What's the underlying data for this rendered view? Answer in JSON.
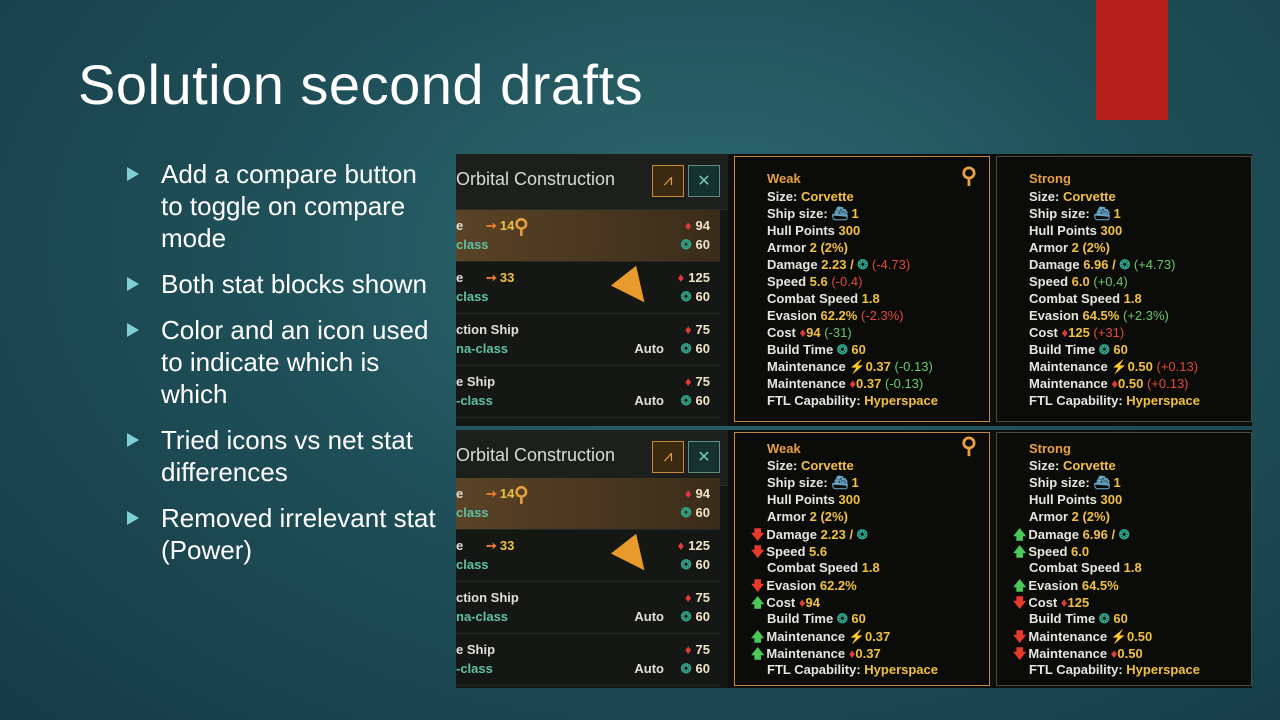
{
  "slide": {
    "title": "Solution second drafts",
    "bullets": [
      "Add a compare button to toggle on compare mode",
      "Both stat blocks shown",
      "Color and an icon used to indicate which is which",
      "Tried icons vs net stat differences",
      "Removed irrelevant stat (Power)"
    ]
  },
  "list": {
    "title": "Orbital Construction",
    "rows": [
      {
        "name1": "e",
        "num": "14",
        "name2": "class",
        "gem": "94",
        "energy": "60",
        "auto": ""
      },
      {
        "name1": "e",
        "num": "33",
        "name2": "class",
        "gem": "125",
        "energy": "60",
        "auto": ""
      },
      {
        "name1": "ction Ship",
        "num": "",
        "name2": "na-class",
        "gem": "75",
        "energy": "60",
        "auto": "Auto"
      },
      {
        "name1": "e Ship",
        "num": "",
        "name2": "-class",
        "gem": "75",
        "energy": "60",
        "auto": "Auto"
      }
    ]
  },
  "weak": {
    "title": "Weak",
    "size": "Size:",
    "size_v": "Corvette",
    "shipsize": "Ship size:",
    "shipsize_v": "1",
    "hull": "Hull Points",
    "hull_v": "300",
    "armor": "Armor",
    "armor_v": "2 (2%)",
    "damage": "Damage",
    "damage_v": "2.23 /",
    "damage_d": "(-4.73)",
    "speed": "Speed",
    "speed_v": "5.6",
    "speed_d": "(-0.4)",
    "cspeed": "Combat Speed",
    "cspeed_v": "1.8",
    "evasion": "Evasion",
    "evasion_v": "62.2%",
    "evasion_d": "(-2.3%)",
    "cost": "Cost",
    "cost_v": "94",
    "cost_d": "(-31)",
    "build": "Build Time",
    "build_v": "60",
    "maint": "Maintenance",
    "maint1_v": "0.37",
    "maint1_d": "(-0.13)",
    "maint2_v": "0.37",
    "maint2_d": "(-0.13)",
    "ftl": "FTL Capability:",
    "ftl_v": "Hyperspace"
  },
  "strong": {
    "title": "Strong",
    "size": "Size:",
    "size_v": "Corvette",
    "shipsize": "Ship size:",
    "shipsize_v": "1",
    "hull": "Hull Points",
    "hull_v": "300",
    "armor": "Armor",
    "armor_v": "2 (2%)",
    "damage": "Damage",
    "damage_v": "6.96 /",
    "damage_d": "(+4.73)",
    "speed": "Speed",
    "speed_v": "6.0",
    "speed_d": "(+0.4)",
    "cspeed": "Combat Speed",
    "cspeed_v": "1.8",
    "evasion": "Evasion",
    "evasion_v": "64.5%",
    "evasion_d": "(+2.3%)",
    "cost": "Cost",
    "cost_v": "125",
    "cost_d": "(+31)",
    "build": "Build Time",
    "build_v": "60",
    "maint": "Maintenance",
    "maint1_v": "0.50",
    "maint1_d": "(+0.13)",
    "maint2_v": "0.50",
    "maint2_d": "(+0.13)",
    "ftl": "FTL Capability:",
    "ftl_v": "Hyperspace"
  },
  "colors": {
    "accent": "#b5201c",
    "gold": "#e8a040",
    "positive": "#6ac86a",
    "negative": "#e04a3a"
  }
}
